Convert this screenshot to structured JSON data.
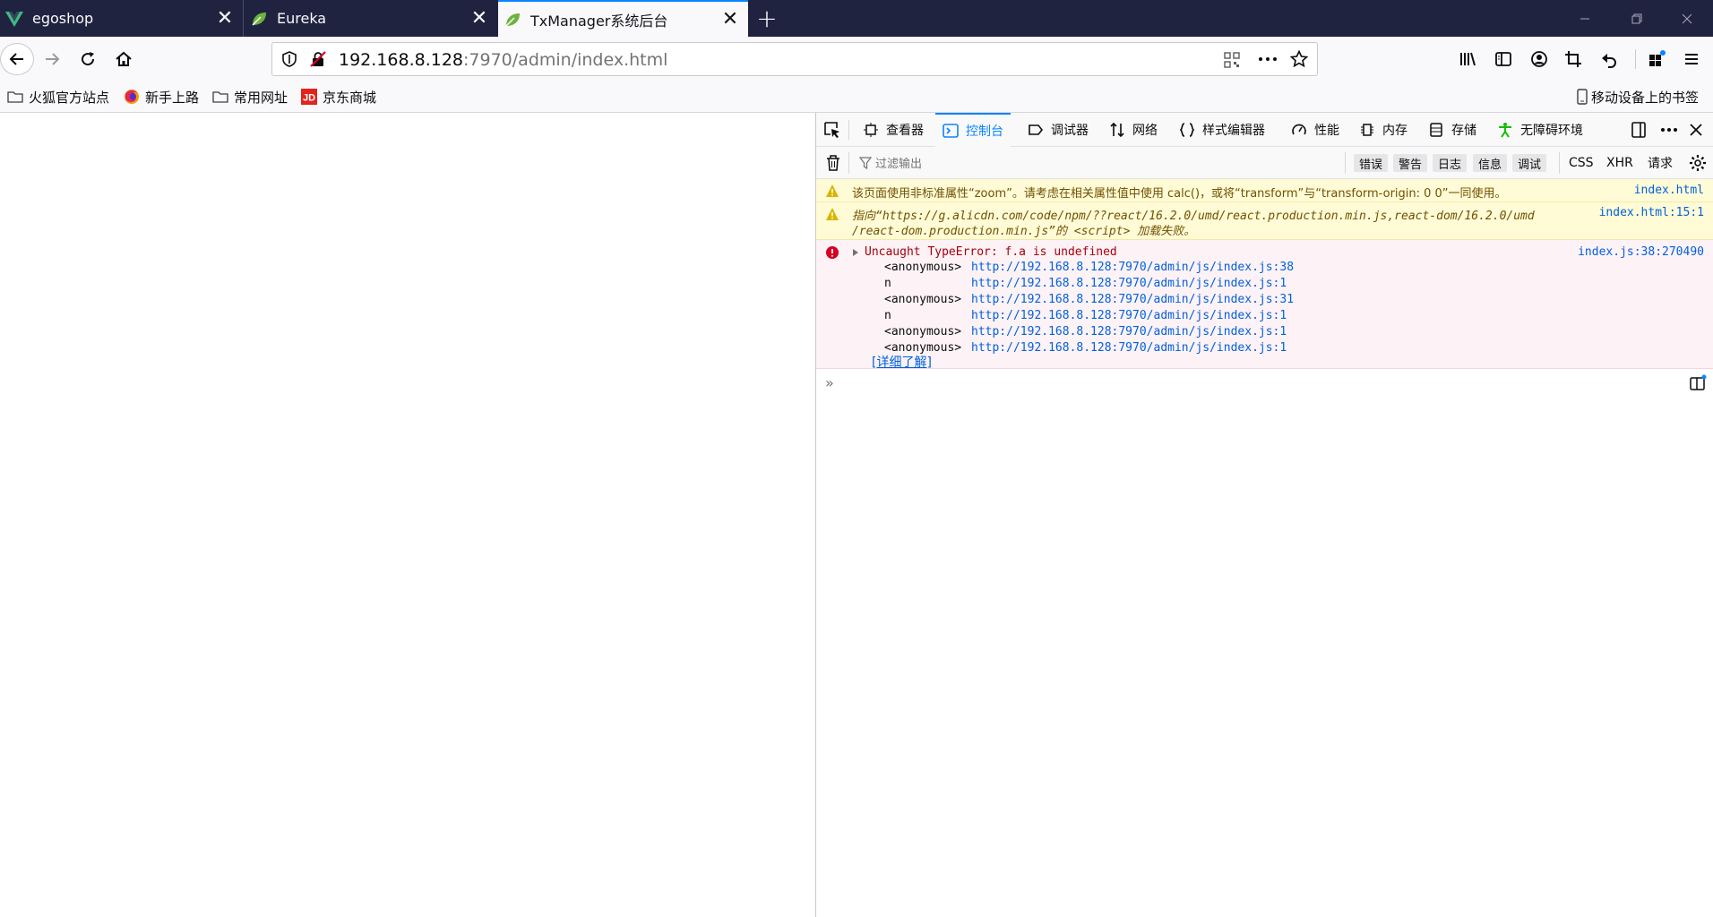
{
  "tabs": [
    {
      "title": "egoshop",
      "icon": "vue-icon"
    },
    {
      "title": "Eureka",
      "icon": "spring-leaf-icon"
    },
    {
      "title": "TxManager系统后台",
      "icon": "spring-leaf-icon"
    }
  ],
  "nav": {
    "url_host": "192.168.8.128",
    "url_rest": ":7970/admin/index.html"
  },
  "bookmarks": [
    {
      "label": "火狐官方站点",
      "icon": "folder-icon"
    },
    {
      "label": "新手上路",
      "icon": "firefox-icon"
    },
    {
      "label": "常用网址",
      "icon": "folder-icon"
    },
    {
      "label": "京东商城",
      "icon": "jd-icon"
    }
  ],
  "mobile_bookmarks": "移动设备上的书签",
  "devtools": {
    "tabs": [
      "查看器",
      "控制台",
      "调试器",
      "网络",
      "样式编辑器",
      "性能",
      "内存",
      "存储",
      "无障碍环境"
    ],
    "active_tab": "控制台",
    "filter_placeholder": "过滤输出",
    "filters": [
      "错误",
      "警告",
      "日志",
      "信息",
      "调试"
    ],
    "filters_plain": [
      "CSS",
      "XHR",
      "请求"
    ],
    "messages": {
      "warn1": {
        "text": "该页面使用非标准属性“zoom”。请考虑在相关属性值中使用 calc()，或将“transform”与“transform-origin: 0 0”一同使用。",
        "source": "index.html"
      },
      "warn2": {
        "line1": "指向“https://g.alicdn.com/code/npm/??react/16.2.0/umd/react.production.min.js,react-dom/16.2.0/umd",
        "line2": "/react-dom.production.min.js”的 <script> 加载失败。",
        "source": "index.html:15:1"
      },
      "error": {
        "text": "Uncaught TypeError: f.a is undefined",
        "source": "index.js:38:270490",
        "stack": [
          {
            "fn": "<anonymous>",
            "url": "http://192.168.8.128:7970/admin/js/index.js:38"
          },
          {
            "fn": "n",
            "url": "http://192.168.8.128:7970/admin/js/index.js:1"
          },
          {
            "fn": "<anonymous>",
            "url": "http://192.168.8.128:7970/admin/js/index.js:31"
          },
          {
            "fn": "n",
            "url": "http://192.168.8.128:7970/admin/js/index.js:1"
          },
          {
            "fn": "<anonymous>",
            "url": "http://192.168.8.128:7970/admin/js/index.js:1"
          },
          {
            "fn": "<anonymous>",
            "url": "http://192.168.8.128:7970/admin/js/index.js:1"
          }
        ],
        "learn_more": "[详细了解]"
      }
    },
    "prompt": "»"
  },
  "colors": {
    "tabstrip": "#202340",
    "accent": "#0a84ff",
    "warning_bg": "#fffbd6",
    "error_bg": "#fdf2f5"
  }
}
